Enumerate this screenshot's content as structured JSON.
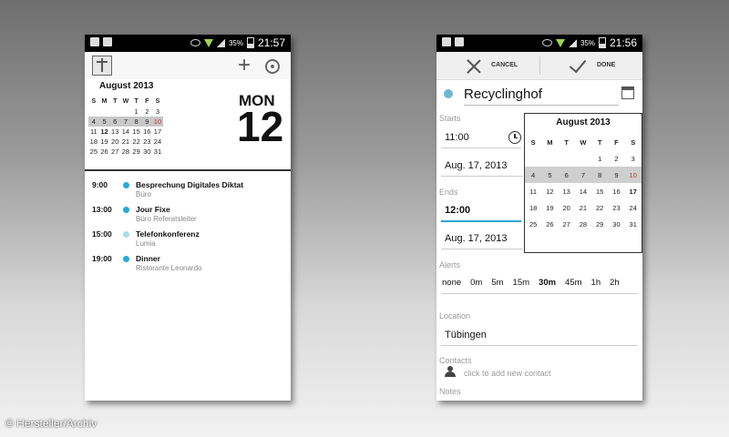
{
  "statusbar": {
    "battery_pct": "35%",
    "time_left": "21:57",
    "time_right": "21:56"
  },
  "phone1": {
    "month_title": "August 2013",
    "weekday_headers": [
      "S",
      "M",
      "T",
      "W",
      "T",
      "F",
      "S"
    ],
    "weeks": [
      [
        "",
        "",
        "",
        "",
        "1",
        "2",
        "3"
      ],
      [
        "4",
        "5",
        "6",
        "7",
        "8",
        "9",
        "10"
      ],
      [
        "11",
        "12",
        "13",
        "14",
        "15",
        "16",
        "17"
      ],
      [
        "18",
        "19",
        "20",
        "21",
        "22",
        "23",
        "24"
      ],
      [
        "25",
        "26",
        "27",
        "28",
        "29",
        "30",
        "31"
      ]
    ],
    "day_name": "MON",
    "day_number": "12",
    "events": [
      {
        "time": "9:00",
        "title": "Besprechung Digitales Diktat",
        "subtitle": "Büro",
        "color": "#29a8d8"
      },
      {
        "time": "13:00",
        "title": "Jour Fixe",
        "subtitle": "Büro Referatsleiter",
        "color": "#29a8d8"
      },
      {
        "time": "15:00",
        "title": "Telefonkonferenz",
        "subtitle": "Lumia",
        "color": "#a8dde8"
      },
      {
        "time": "19:00",
        "title": "Dinner",
        "subtitle": "Ristorante Leonardo",
        "color": "#29a8d8"
      }
    ]
  },
  "phone2": {
    "cancel_label": "CANCEL",
    "done_label": "DONE",
    "event_title": "Recyclinghof",
    "starts_label": "Starts",
    "start_time": "11:00",
    "start_date": "Aug. 17, 2013",
    "ends_label": "Ends",
    "end_time": "12:00",
    "end_date": "Aug. 17, 2013",
    "alerts_label": "Alerts",
    "alerts": [
      "none",
      "0m",
      "5m",
      "15m",
      "30m",
      "45m",
      "1h",
      "2h"
    ],
    "location_label": "Location",
    "location_value": "Tübingen",
    "contacts_label": "Contacts",
    "contacts_placeholder": "click to add new contact",
    "notes_label": "Notes",
    "popup": {
      "month_title": "August 2013",
      "weekday_headers": [
        "S",
        "M",
        "T",
        "W",
        "T",
        "F",
        "S"
      ],
      "weeks": [
        [
          "",
          "",
          "",
          "",
          "1",
          "2",
          "3"
        ],
        [
          "4",
          "5",
          "6",
          "7",
          "8",
          "9",
          "10"
        ],
        [
          "11",
          "12",
          "13",
          "14",
          "15",
          "16",
          "17"
        ],
        [
          "18",
          "19",
          "20",
          "21",
          "22",
          "23",
          "24"
        ],
        [
          "25",
          "26",
          "27",
          "28",
          "29",
          "30",
          "31"
        ]
      ]
    }
  },
  "watermark": "© Hersteller/Archiv"
}
